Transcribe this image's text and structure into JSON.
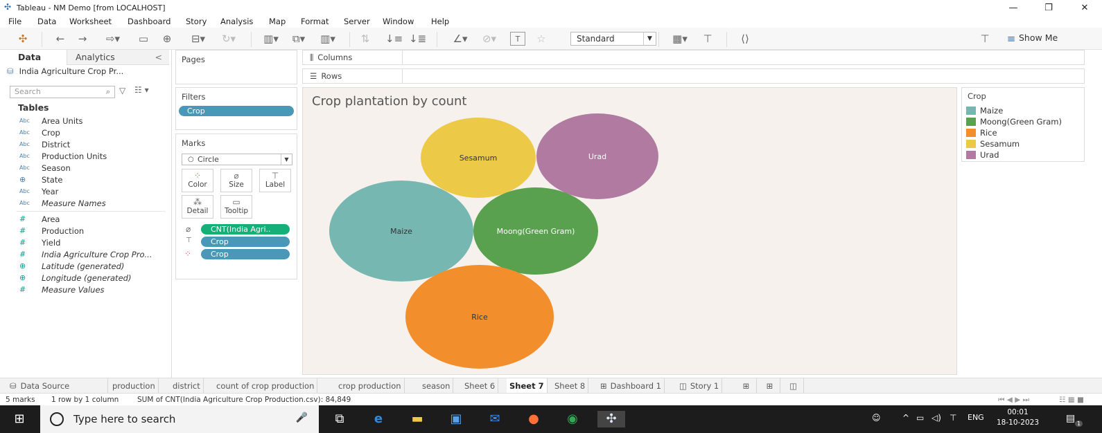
{
  "window": {
    "title": "Tableau - NM Demo [from LOCALHOST]"
  },
  "menu": [
    "File",
    "Data",
    "Worksheet",
    "Dashboard",
    "Story",
    "Analysis",
    "Map",
    "Format",
    "Server",
    "Window",
    "Help"
  ],
  "toolbar": {
    "fit_value": "Standard",
    "show_me_label": "Show Me"
  },
  "data_pane": {
    "tab_data": "Data",
    "tab_analytics": "Analytics",
    "source": "India Agriculture Crop Pr...",
    "search_placeholder": "Search",
    "tables_label": "Tables",
    "dimensions": [
      {
        "type": "Abc",
        "name": "Area Units",
        "italic": false
      },
      {
        "type": "Abc",
        "name": "Crop",
        "italic": false
      },
      {
        "type": "Abc",
        "name": "District",
        "italic": false
      },
      {
        "type": "Abc",
        "name": "Production Units",
        "italic": false
      },
      {
        "type": "Abc",
        "name": "Season",
        "italic": false
      },
      {
        "type": "geo",
        "name": "State",
        "italic": false
      },
      {
        "type": "Abc",
        "name": "Year",
        "italic": false
      },
      {
        "type": "Abc",
        "name": "Measure Names",
        "italic": true
      }
    ],
    "measures": [
      {
        "type": "#",
        "name": "Area",
        "italic": false
      },
      {
        "type": "#",
        "name": "Production",
        "italic": false
      },
      {
        "type": "#",
        "name": "Yield",
        "italic": false
      },
      {
        "type": "#",
        "name": "India Agriculture Crop Pro...",
        "italic": true
      },
      {
        "type": "geo",
        "name": "Latitude (generated)",
        "italic": true
      },
      {
        "type": "geo",
        "name": "Longitude (generated)",
        "italic": true
      },
      {
        "type": "#",
        "name": "Measure Values",
        "italic": true
      }
    ]
  },
  "pages_label": "Pages",
  "filters": {
    "label": "Filters",
    "pill": "Crop"
  },
  "marks": {
    "label": "Marks",
    "mark_type": "Circle",
    "buttons": [
      "Color",
      "Size",
      "Label",
      "Detail",
      "Tooltip"
    ],
    "size_pill": "CNT(India Agri..",
    "label_pill": "Crop",
    "color_pill": "Crop"
  },
  "shelves": {
    "columns": "Columns",
    "rows": "Rows"
  },
  "view": {
    "title": "Crop plantation by count"
  },
  "chart_data": {
    "type": "packed-bubble",
    "title": "Crop plantation by count",
    "size_measure": "CNT(India Agriculture Crop Production.csv)",
    "total": 84849,
    "bubbles": [
      {
        "label": "Sesamum",
        "color": "#EDC948",
        "label_color": "#333333"
      },
      {
        "label": "Urad",
        "color": "#B07AA1",
        "label_color": "#ffffff"
      },
      {
        "label": "Maize",
        "color": "#76B7B2",
        "label_color": "#333333"
      },
      {
        "label": "Moong(Green Gram)",
        "color": "#59A14F",
        "label_color": "#ffffff"
      },
      {
        "label": "Rice",
        "color": "#F28E2B",
        "label_color": "#333333"
      }
    ]
  },
  "legend": {
    "title": "Crop",
    "items": [
      {
        "label": "Maize",
        "color": "#76B7B2"
      },
      {
        "label": "Moong(Green Gram)",
        "color": "#59A14F"
      },
      {
        "label": "Rice",
        "color": "#F28E2B"
      },
      {
        "label": "Sesamum",
        "color": "#EDC948"
      },
      {
        "label": "Urad",
        "color": "#B07AA1"
      }
    ]
  },
  "sheet_tabs": [
    "Data Source",
    "production",
    "district",
    "count of crop production",
    "crop production",
    "season",
    "Sheet 6",
    "Sheet 7",
    "Sheet 8",
    "Dashboard 1",
    "Story 1"
  ],
  "active_sheet": "Sheet 7",
  "status": {
    "marks": "5 marks",
    "layout": "1 row by 1 column",
    "summary": "SUM of CNT(India Agriculture Crop Production.csv): 84,849"
  },
  "taskbar": {
    "search_placeholder": "Type here to search",
    "language": "ENG",
    "time": "00:01",
    "date": "18-10-2023",
    "notification_count": "1"
  }
}
